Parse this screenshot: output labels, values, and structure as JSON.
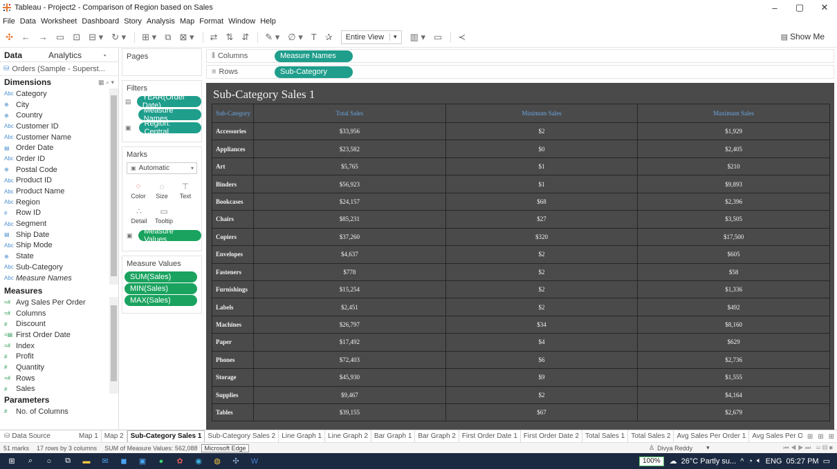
{
  "window": {
    "title": "Tableau - Project2 - Comparison of Region based on Sales",
    "controls": [
      "–",
      "▢",
      "✕"
    ]
  },
  "menu": [
    "File",
    "Data",
    "Worksheet",
    "Dashboard",
    "Story",
    "Analysis",
    "Map",
    "Format",
    "Window",
    "Help"
  ],
  "toolbar": {
    "view_select": "Entire View",
    "show_me": "Show Me"
  },
  "data_pane": {
    "tab_data": "Data",
    "tab_analytics": "Analytics",
    "datasource": "Orders (Sample - Superst...",
    "dimensions_header": "Dimensions",
    "dimensions": [
      {
        "icon": "Abc",
        "name": "Category"
      },
      {
        "icon": "⊕",
        "name": "City"
      },
      {
        "icon": "⊕",
        "name": "Country"
      },
      {
        "icon": "Abc",
        "name": "Customer ID"
      },
      {
        "icon": "Abc",
        "name": "Customer Name"
      },
      {
        "icon": "▤",
        "name": "Order Date"
      },
      {
        "icon": "Abc",
        "name": "Order ID"
      },
      {
        "icon": "⊕",
        "name": "Postal Code"
      },
      {
        "icon": "Abc",
        "name": "Product ID"
      },
      {
        "icon": "Abc",
        "name": "Product Name"
      },
      {
        "icon": "Abc",
        "name": "Region"
      },
      {
        "icon": "#",
        "name": "Row ID"
      },
      {
        "icon": "Abc",
        "name": "Segment"
      },
      {
        "icon": "▤",
        "name": "Ship Date"
      },
      {
        "icon": "Abc",
        "name": "Ship Mode"
      },
      {
        "icon": "⊕",
        "name": "State"
      },
      {
        "icon": "Abc",
        "name": "Sub-Category"
      },
      {
        "icon": "Abc",
        "name": "Measure Names"
      }
    ],
    "measures_header": "Measures",
    "measures": [
      {
        "icon": "=#",
        "name": "Avg Sales Per Order"
      },
      {
        "icon": "=#",
        "name": "Columns"
      },
      {
        "icon": "#",
        "name": "Discount"
      },
      {
        "icon": "=▤",
        "name": "First Order Date"
      },
      {
        "icon": "=#",
        "name": "Index"
      },
      {
        "icon": "#",
        "name": "Profit"
      },
      {
        "icon": "#",
        "name": "Quantity"
      },
      {
        "icon": "=#",
        "name": "Rows"
      },
      {
        "icon": "#",
        "name": "Sales"
      }
    ],
    "parameters_header": "Parameters",
    "parameters": [
      {
        "icon": "#",
        "name": "No. of Columns"
      }
    ]
  },
  "shelves": {
    "pages_label": "Pages",
    "filters_label": "Filters",
    "filters": [
      "YEAR(Order Date)",
      "Measure Names",
      "Region: Central"
    ],
    "marks_label": "Marks",
    "mark_type": "Automatic",
    "mark_buttons": [
      "Color",
      "Size",
      "Text",
      "Detail",
      "Tooltip"
    ],
    "marks_pill": "Measure Values",
    "measure_values_label": "Measure Values",
    "measure_values": [
      "SUM(Sales)",
      "MIN(Sales)",
      "MAX(Sales)"
    ],
    "columns_label": "Columns",
    "columns_pill": "Measure Names",
    "rows_label": "Rows",
    "rows_pill": "Sub-Category"
  },
  "viz": {
    "title": "Sub-Category Sales 1",
    "headers": [
      "Sub-Category",
      "Total Sales",
      "Minimum Sales",
      "Maximum Sales"
    ],
    "rows": [
      [
        "Accessories",
        "$33,956",
        "$2",
        "$1,929"
      ],
      [
        "Appliances",
        "$23,582",
        "$0",
        "$2,405"
      ],
      [
        "Art",
        "$5,765",
        "$1",
        "$210"
      ],
      [
        "Binders",
        "$56,923",
        "$1",
        "$9,893"
      ],
      [
        "Bookcases",
        "$24,157",
        "$68",
        "$2,396"
      ],
      [
        "Chairs",
        "$85,231",
        "$27",
        "$3,505"
      ],
      [
        "Copiers",
        "$37,260",
        "$320",
        "$17,500"
      ],
      [
        "Envelopes",
        "$4,637",
        "$2",
        "$605"
      ],
      [
        "Fasteners",
        "$778",
        "$2",
        "$58"
      ],
      [
        "Furnishings",
        "$15,254",
        "$2",
        "$1,336"
      ],
      [
        "Labels",
        "$2,451",
        "$2",
        "$492"
      ],
      [
        "Machines",
        "$26,797",
        "$34",
        "$8,160"
      ],
      [
        "Paper",
        "$17,492",
        "$4",
        "$629"
      ],
      [
        "Phones",
        "$72,403",
        "$6",
        "$2,736"
      ],
      [
        "Storage",
        "$45,930",
        "$9",
        "$1,555"
      ],
      [
        "Supplies",
        "$9,467",
        "$2",
        "$4,164"
      ],
      [
        "Tables",
        "$39,155",
        "$67",
        "$2,679"
      ]
    ]
  },
  "sheet_tabs": {
    "data_source": "Data Source",
    "tabs": [
      "Map 1",
      "Map 2",
      "Sub-Category Sales 1",
      "Sub-Category Sales 2",
      "Line Graph 1",
      "Line Graph 2",
      "Bar Graph 1",
      "Bar Graph 2",
      "First Order Date 1",
      "First Order Date 2",
      "Total Sales 1",
      "Total Sales 2",
      "Avg Sales Per Order 1",
      "Avg Sales Per Ord"
    ],
    "active_index": 2
  },
  "status": {
    "marks": "51 marks",
    "dims": "17 rows by 3 columns",
    "sum": "SUM of Measure Values: 562,088",
    "tooltip": "Microsoft Edge",
    "user": "Divya Reddy"
  },
  "taskbar": {
    "battery": "100%",
    "weather": "26°C  Partly su...",
    "lang": "ENG",
    "time": "05:27 PM"
  },
  "colors": {
    "pill_teal": "#1f9e8c",
    "pill_green": "#1aa35f",
    "viz_bg": "#4a4a4a",
    "header_text": "#6aa6e0",
    "taskbar": "#1b2a41"
  }
}
